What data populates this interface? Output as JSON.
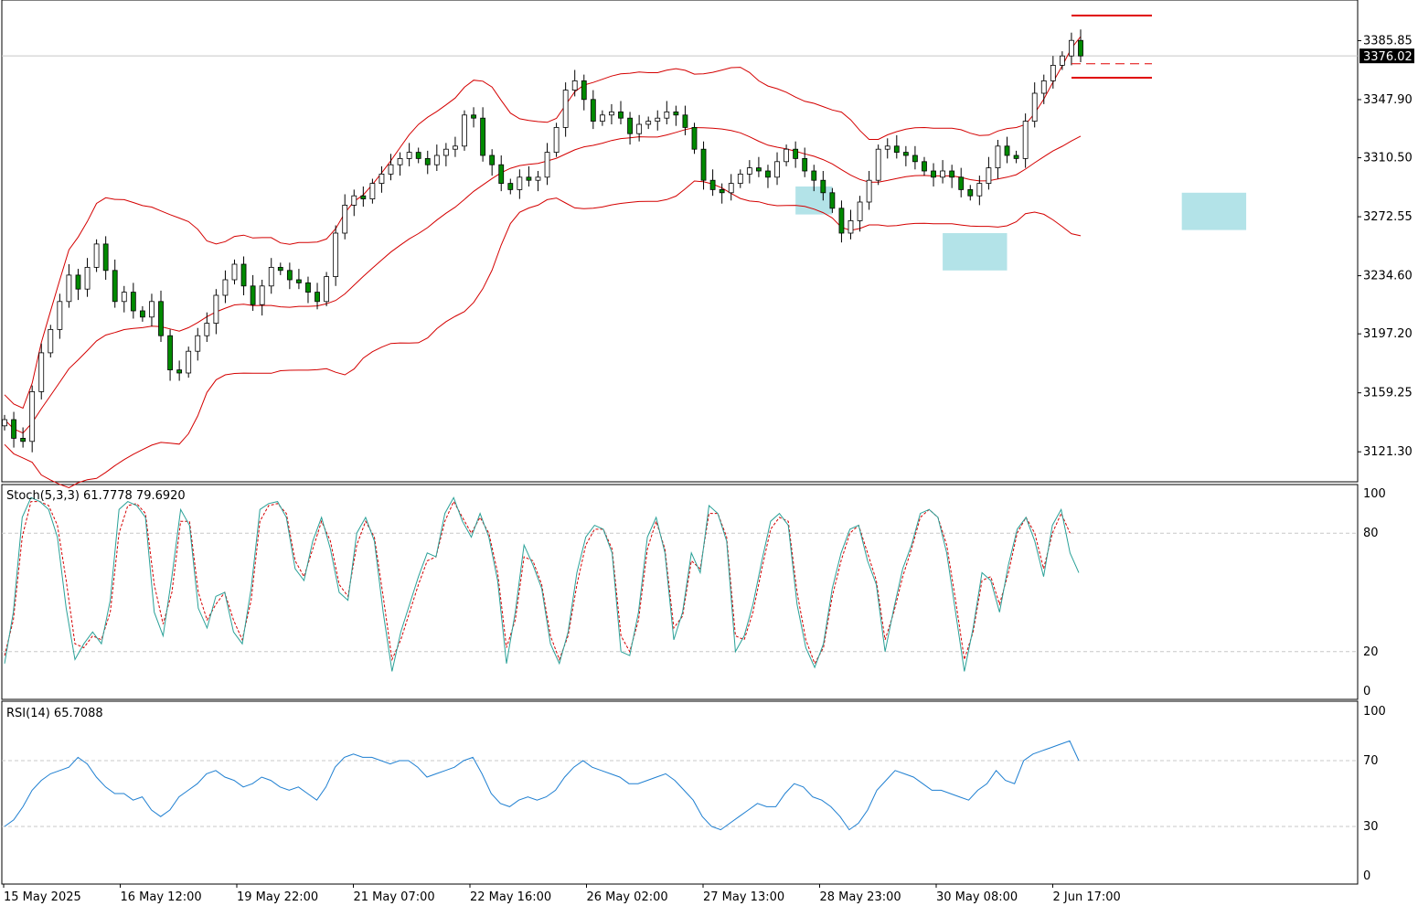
{
  "chart_data": [
    {
      "type": "candlestick",
      "panel": "price",
      "indicator_overlay": "Bollinger Bands",
      "y_ticks": [
        "3385.85",
        "3347.90",
        "3310.50",
        "3272.55",
        "3234.60",
        "3197.20",
        "3159.25",
        "3121.30"
      ],
      "ylim": [
        3102,
        3412
      ],
      "current_price": "3376.02",
      "current_price_value": 3376.02,
      "colors": {
        "up": "#008a00",
        "down": "#008a00",
        "bands": "#d40000",
        "highlight": "#b3e3e8",
        "price_line": "#c8c8c8"
      },
      "closes": [
        3142,
        3130,
        3128,
        3160,
        3185,
        3200,
        3218,
        3235,
        3226,
        3240,
        3255,
        3238,
        3218,
        3224,
        3212,
        3208,
        3218,
        3196,
        3174,
        3172,
        3186,
        3196,
        3204,
        3222,
        3232,
        3242,
        3228,
        3216,
        3228,
        3240,
        3238,
        3232,
        3230,
        3224,
        3218,
        3234,
        3262,
        3280,
        3286,
        3284,
        3294,
        3300,
        3306,
        3310,
        3314,
        3310,
        3306,
        3312,
        3316,
        3318,
        3338,
        3336,
        3312,
        3306,
        3294,
        3290,
        3298,
        3296,
        3298,
        3314,
        3330,
        3354,
        3360,
        3348,
        3334,
        3338,
        3340,
        3336,
        3326,
        3332,
        3334,
        3336,
        3340,
        3338,
        3330,
        3316,
        3296,
        3290,
        3288,
        3294,
        3300,
        3304,
        3302,
        3298,
        3308,
        3316,
        3310,
        3302,
        3296,
        3288,
        3278,
        3262,
        3270,
        3282,
        3296,
        3316,
        3318,
        3314,
        3312,
        3308,
        3302,
        3298,
        3302,
        3298,
        3290,
        3286,
        3294,
        3304,
        3318,
        3312,
        3310,
        3334,
        3352,
        3360,
        3370,
        3376,
        3386,
        3376
      ],
      "x_tick_labels": [
        "15 May 2025",
        "16 May 12:00",
        "19 May 22:00",
        "21 May 07:00",
        "22 May 16:00",
        "26 May 02:00",
        "27 May 13:00",
        "28 May 23:00",
        "30 May 08:00",
        "2 Jun 17:00"
      ],
      "highlight_zones": [
        {
          "x_from_candle": 86,
          "x_to_candle": 90,
          "y_from": 3274,
          "y_to": 3292
        },
        {
          "x_from_candle": 102,
          "x_to_candle": 109,
          "y_from": 3238,
          "y_to": 3262
        },
        {
          "x_from_candle": 128,
          "x_to_candle": 135,
          "y_from": 3264,
          "y_to": 3288
        }
      ],
      "level_lines": [
        {
          "value": 3402,
          "style": "solid"
        },
        {
          "value": 3371,
          "style": "dashed"
        },
        {
          "value": 3362,
          "style": "solid"
        }
      ]
    },
    {
      "type": "line",
      "panel": "stochastic",
      "label": "Stoch(5,3,3) 61.7778 79.6920",
      "y_ticks": [
        "100",
        "80",
        "20",
        "0"
      ],
      "ylim": [
        0,
        100
      ],
      "levels": [
        20,
        80
      ],
      "main_line": [
        14,
        40,
        88,
        98,
        96,
        92,
        78,
        42,
        16,
        24,
        30,
        24,
        46,
        92,
        96,
        94,
        88,
        40,
        28,
        58,
        92,
        84,
        42,
        32,
        48,
        50,
        30,
        24,
        52,
        92,
        95,
        96,
        88,
        62,
        56,
        76,
        88,
        72,
        50,
        46,
        80,
        88,
        76,
        40,
        10,
        30,
        44,
        58,
        70,
        68,
        90,
        98,
        86,
        78,
        90,
        78,
        56,
        14,
        40,
        74,
        64,
        52,
        24,
        14,
        30,
        60,
        78,
        84,
        82,
        70,
        20,
        18,
        40,
        78,
        88,
        70,
        26,
        40,
        70,
        60,
        94,
        90,
        76,
        20,
        28,
        44,
        66,
        86,
        90,
        84,
        44,
        22,
        12,
        24,
        52,
        70,
        82,
        84,
        66,
        54,
        20,
        42,
        62,
        74,
        90,
        92,
        88,
        70,
        40,
        10,
        32,
        60,
        56,
        40,
        64,
        82,
        88,
        76,
        58,
        84,
        92,
        70,
        60
      ],
      "signal_line": [
        18,
        36,
        78,
        96,
        96,
        94,
        84,
        56,
        24,
        22,
        28,
        26,
        40,
        80,
        94,
        95,
        90,
        54,
        34,
        50,
        86,
        86,
        50,
        36,
        44,
        50,
        36,
        26,
        46,
        86,
        94,
        95,
        90,
        66,
        58,
        72,
        86,
        76,
        54,
        48,
        74,
        86,
        78,
        48,
        16,
        26,
        40,
        54,
        66,
        68,
        86,
        96,
        88,
        80,
        88,
        80,
        60,
        22,
        36,
        68,
        66,
        54,
        28,
        16,
        28,
        54,
        74,
        82,
        82,
        72,
        28,
        20,
        36,
        72,
        86,
        72,
        32,
        38,
        66,
        62,
        90,
        90,
        78,
        28,
        26,
        40,
        62,
        82,
        88,
        86,
        50,
        26,
        14,
        22,
        48,
        66,
        80,
        84,
        70,
        56,
        26,
        40,
        58,
        72,
        88,
        92,
        88,
        74,
        46,
        16,
        30,
        56,
        58,
        44,
        60,
        80,
        88,
        80,
        62,
        80,
        90,
        80
      ]
    },
    {
      "type": "line",
      "panel": "rsi",
      "label": "RSI(14) 65.7088",
      "y_ticks": [
        "100",
        "70",
        "30",
        "0"
      ],
      "ylim": [
        0,
        100
      ],
      "levels": [
        30,
        70
      ],
      "values": [
        30,
        34,
        42,
        52,
        58,
        62,
        64,
        66,
        72,
        68,
        60,
        54,
        50,
        50,
        46,
        48,
        40,
        36,
        40,
        48,
        52,
        56,
        62,
        64,
        60,
        58,
        54,
        56,
        60,
        58,
        54,
        52,
        54,
        50,
        46,
        54,
        66,
        72,
        74,
        72,
        72,
        70,
        68,
        70,
        70,
        66,
        60,
        62,
        64,
        66,
        70,
        72,
        62,
        50,
        44,
        42,
        46,
        48,
        46,
        48,
        52,
        60,
        66,
        70,
        66,
        64,
        62,
        60,
        56,
        56,
        58,
        60,
        62,
        58,
        52,
        46,
        36,
        30,
        28,
        32,
        36,
        40,
        44,
        42,
        42,
        50,
        56,
        54,
        48,
        46,
        42,
        36,
        28,
        32,
        40,
        52,
        58,
        64,
        62,
        60,
        56,
        52,
        52,
        50,
        48,
        46,
        52,
        56,
        64,
        58,
        56,
        70,
        74,
        76,
        78,
        80,
        82,
        70
      ]
    }
  ]
}
